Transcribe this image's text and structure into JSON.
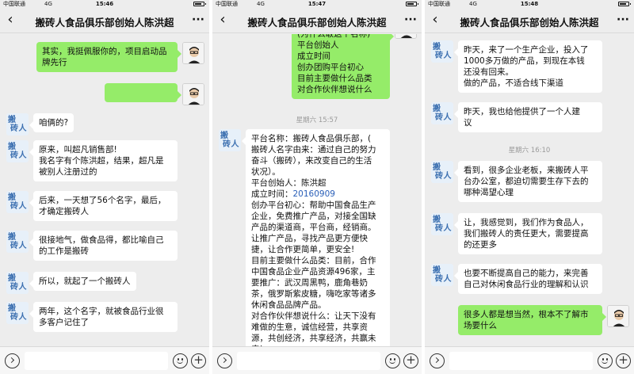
{
  "phones": [
    {
      "status": {
        "carrier": "中国联通",
        "network": "4G",
        "time": "15:46"
      },
      "title": "搬砖人食品俱乐部创始人陈洪超",
      "messages": [
        {
          "side": "right",
          "text": "其实，我挺佩服你的，项目启动品\n牌先行"
        },
        {
          "side": "right",
          "text": "　　　　　　　　"
        },
        {
          "side": "left",
          "text": "咱俩的?"
        },
        {
          "side": "left",
          "text": "原来，叫超凡销售部!\n我名字有个陈洪超，结果，超凡是\n被别人注册过的"
        },
        {
          "side": "left",
          "text": "后来，一天想了56个名字，最后，\n才确定搬砖人"
        },
        {
          "side": "left",
          "text": "很接地气，做食品得，都比喻自己\n的工作是搬砖"
        },
        {
          "side": "left",
          "text": "所以，就起了一个搬砖人"
        },
        {
          "side": "left",
          "text": "两年，这个名字，就被食品行业很\n多客户记住了"
        }
      ]
    },
    {
      "status": {
        "carrier": "中国联通",
        "network": "4G",
        "time": "15:47"
      },
      "title": "搬砖人食品俱乐部创始人陈洪超",
      "messages": [
        {
          "side": "right",
          "text": "(为什么取这个名称)\n平台创始人\n成立时间\n创办团购平台初心\n目前主要做什么品类\n对合作伙伴想说什么"
        }
      ],
      "timestamp": "星期六 15:57",
      "long_message": {
        "before_link": "平台名称：搬砖人食品俱乐部，(\n搬砖人名字由来：通过自己的努力\n奋斗（搬砖），来改变自己的生活\n状况）。\n平台创始人：陈洪超\n成立时间：",
        "link": "20160909",
        "after_link": "\n创办平台初心：帮助中国食品生产\n企业，免费推广产品，对接全国缺\n产品的渠道商，平台商，经销商。\n让推广产品，寻找产品更方便快\n捷，让合作更简单，更安全!\n目前主要做什么品类：目前，合作\n中国食品企业产品资源496家，主\n要推广：武汉周黑鸭，鹿角巷奶\n茶，俄罗斯紫皮糖，嗨吃家等诸多\n休闲食品品牌产品。\n对合作伙伴想说什么：让天下没有\n难做的生意，诚信经营，共享资\n源，共创经济，共享经济，共赢未\n来!"
      }
    },
    {
      "status": {
        "carrier": "中国联通",
        "network": "4G",
        "time": "15:48"
      },
      "title": "搬砖人食品俱乐部创始人陈洪超",
      "messages": [
        {
          "side": "left",
          "text": "昨天，来了一个生产企业，投入了\n1000多万做的产品，到现在本钱\n还没有回来。\n做的产品，不适合线下渠道"
        },
        {
          "side": "left",
          "text": "昨天，我也给他提供了一个人建\n议"
        },
        {
          "side": "left",
          "text": "看到，很多企业老板，来搬砖人平\n台办公室，都迫切需要生存下去的\n哪种渴望心理"
        },
        {
          "side": "left",
          "text": "让，我感觉到，我们作为食品人，\n我们搬砖人的责任更大，需要提高\n的还更多"
        },
        {
          "side": "left",
          "text": "也要不断提高自己的能力，来完善\n自己对休闲食品行业的理解和认识"
        },
        {
          "side": "right",
          "text": "很多人都是想当然，根本不了解市\n场要什么"
        }
      ],
      "timestamp": "星期六 16:10"
    }
  ],
  "icons": {
    "back": "chevron-left-icon",
    "more": "more-dots-icon",
    "voice": "voice-icon",
    "emoji": "emoji-icon",
    "plus": "plus-icon"
  },
  "avatar_logo": {
    "line1": "搬",
    "line2": "砖人"
  },
  "colors": {
    "background": "#ededed",
    "bubble_sent": "#95ec69",
    "bubble_received": "#ffffff",
    "link": "#2a5fb8"
  }
}
